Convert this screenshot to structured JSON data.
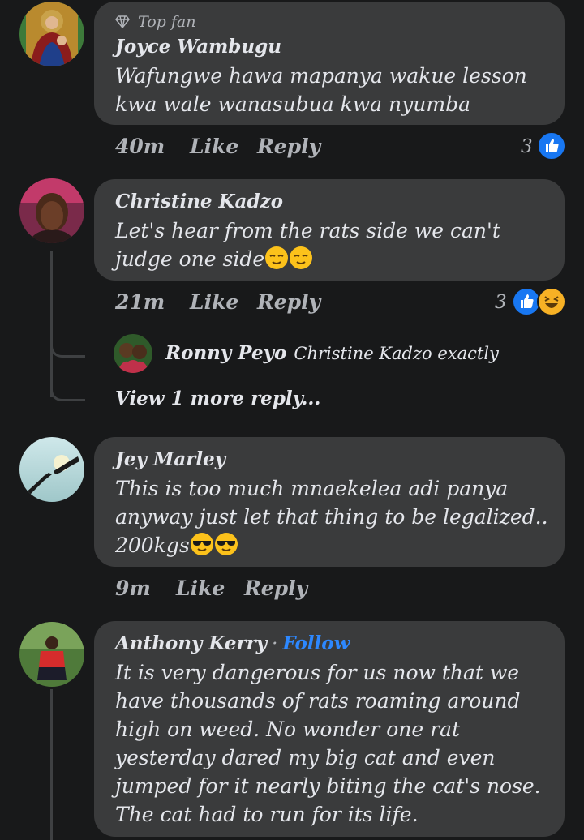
{
  "colors": {
    "background": "#18191a",
    "bubble": "#3a3b3c",
    "text": "#e4e6eb",
    "secondary": "#b0b3b8",
    "like_blue": "#1877f2",
    "follow_blue": "#2d88ff"
  },
  "comments": [
    {
      "badge": "Top fan",
      "badge_icon": "diamond-icon",
      "author": "Joyce Wambugu",
      "text": "Wafungwe hawa mapanya wakue lesson kwa wale wanasubua kwa nyumba",
      "time": "40m",
      "like_label": "Like",
      "reply_label": "Reply",
      "reaction_count": "3",
      "reactions": [
        "like"
      ]
    },
    {
      "author": "Christine Kadzo",
      "text": "Let's hear from the rats side we can't judge one side",
      "emojis": [
        "relieved-face",
        "relieved-face"
      ],
      "time": "21m",
      "like_label": "Like",
      "reply_label": "Reply",
      "reaction_count": "3",
      "reactions": [
        "like",
        "haha"
      ],
      "replies": [
        {
          "author": "Ronny Peyo",
          "text": "Christine Kadzo exactly"
        }
      ],
      "view_more": "View 1 more reply..."
    },
    {
      "author": "Jey Marley",
      "text_line1": "This is too much mnaekelea adi panya",
      "text_line2": "anyway just let that thing to be legalized..",
      "text_line3": "200kgs",
      "emojis": [
        "sunglasses-face",
        "sunglasses-face"
      ],
      "time": "9m",
      "like_label": "Like",
      "reply_label": "Reply"
    },
    {
      "author": "Anthony Kerry",
      "separator": "·",
      "follow_label": "Follow",
      "text": "It is very dangerous for us now that we have thousands of rats roaming around high on weed. No wonder one rat yesterday dared my big cat and even jumped for it nearly biting the cat's nose. The cat had to run for its life."
    }
  ]
}
